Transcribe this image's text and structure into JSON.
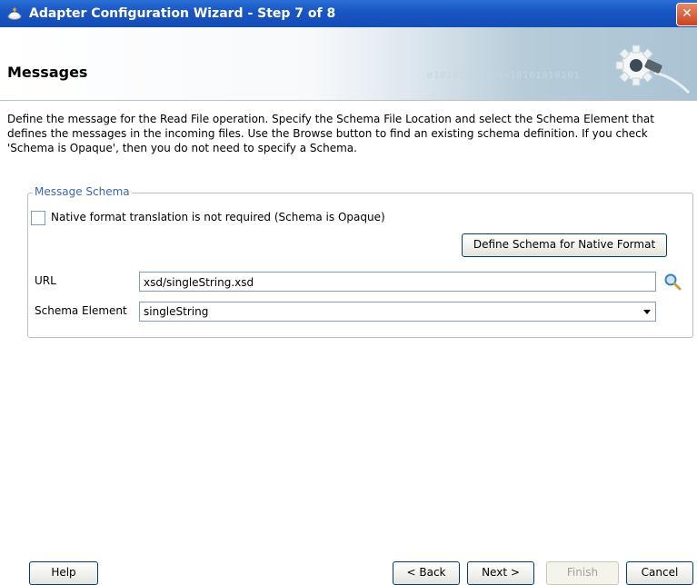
{
  "window": {
    "title": "Adapter Configuration Wizard - Step 7 of 8",
    "close_glyph": "✕"
  },
  "banner": {
    "heading": "Messages",
    "binary_text": "010101010101010101010101"
  },
  "description": "Define the message for the Read File operation.  Specify the Schema File Location and select the Schema Element that defines the messages in the incoming files. Use the Browse button to find an existing schema definition. If you check 'Schema is Opaque', then you do not need to specify a Schema.",
  "message_schema": {
    "legend": "Message Schema",
    "opaque_checkbox_label": "Native format translation is not required (Schema is Opaque)",
    "opaque_checked": false,
    "define_button": "Define Schema for Native Format",
    "url_label": "URL",
    "url_value": "xsd/singleString.xsd",
    "schema_element_label": "Schema Element",
    "schema_element_value": "singleString"
  },
  "buttons": {
    "help": "Help",
    "back": "< Back",
    "next": "Next >",
    "finish": "Finish",
    "cancel": "Cancel"
  },
  "colors": {
    "titlebar": "#1a56c4",
    "legend_text": "#3b66b4"
  },
  "icons": {
    "app": "adapter-icon",
    "close": "close-icon",
    "gear": "gear-plug-icon",
    "search": "search-icon",
    "dropdown": "chevron-down-icon"
  }
}
